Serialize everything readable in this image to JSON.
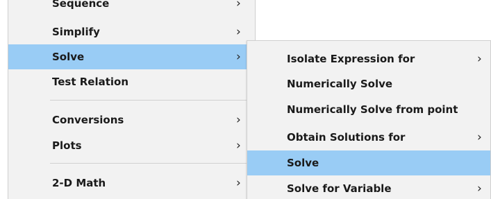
{
  "main_menu": {
    "items": [
      {
        "label": "Sequence",
        "chevron": "›"
      },
      {
        "label": "Simplify",
        "chevron": "›"
      },
      {
        "label": "Solve",
        "chevron": "›"
      },
      {
        "label": "Test Relation",
        "chevron": ""
      },
      {
        "label": "Conversions",
        "chevron": "›"
      },
      {
        "label": "Plots",
        "chevron": "›"
      },
      {
        "label": "2-D Math",
        "chevron": "›"
      }
    ],
    "highlighted": "Solve"
  },
  "sub_menu": {
    "items": [
      {
        "label": "Isolate Expression for",
        "chevron": "›"
      },
      {
        "label": "Numerically Solve",
        "chevron": ""
      },
      {
        "label": "Numerically Solve from point",
        "chevron": ""
      },
      {
        "label": "Obtain Solutions for",
        "chevron": "›"
      },
      {
        "label": "Solve",
        "chevron": ""
      },
      {
        "label": "Solve for Variable",
        "chevron": "›"
      }
    ],
    "highlighted": "Solve"
  },
  "colors": {
    "menu_background": "#f2f2f2",
    "highlight": "#99ccf5",
    "text": "#1a1a1a"
  },
  "icons": {
    "submenu_arrow": "chevron-right-icon"
  }
}
